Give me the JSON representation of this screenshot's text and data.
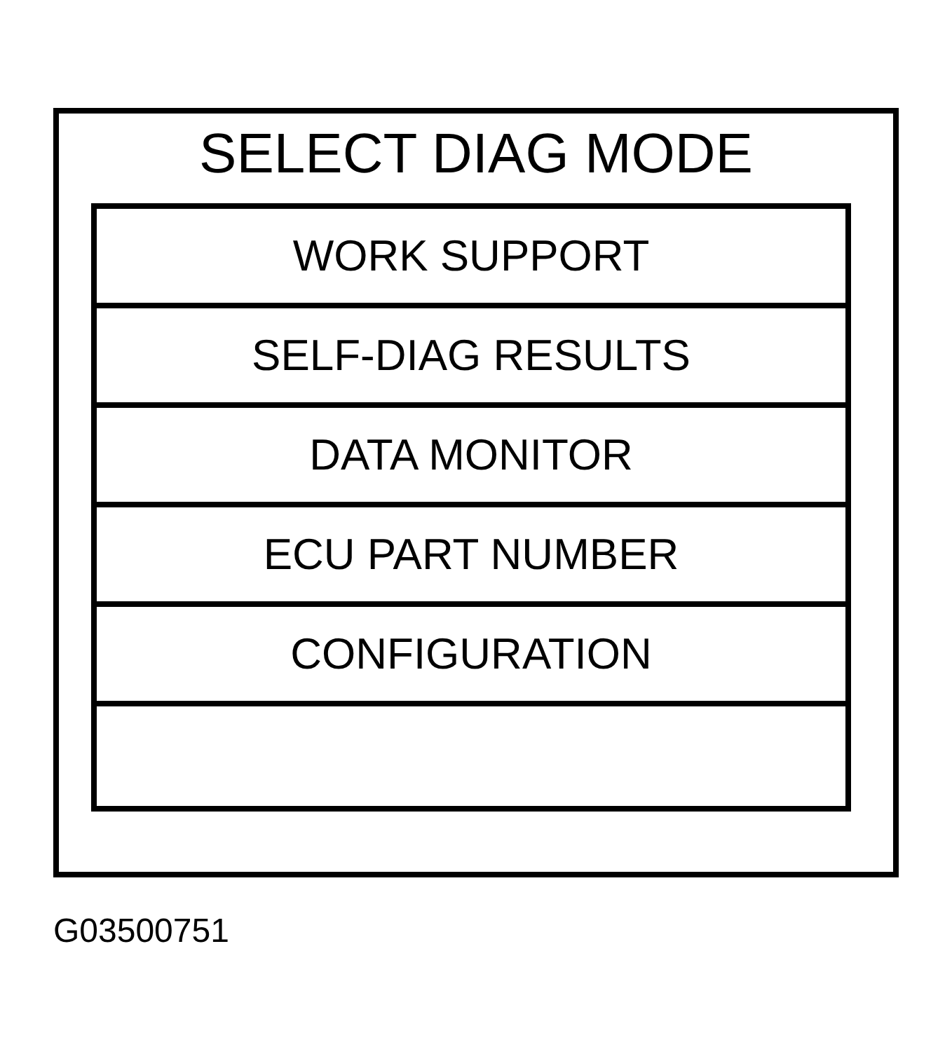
{
  "screen": {
    "title": "SELECT DIAG MODE",
    "menu_items": [
      {
        "kind": "option",
        "label": "WORK SUPPORT"
      },
      {
        "kind": "option",
        "label": "SELF-DIAG RESULTS"
      },
      {
        "kind": "option",
        "label": "DATA MONITOR"
      },
      {
        "kind": "option",
        "label": "ECU PART NUMBER"
      },
      {
        "kind": "option",
        "label": "CONFIGURATION"
      },
      {
        "kind": "blank"
      }
    ]
  },
  "figure_code": "G03500751"
}
